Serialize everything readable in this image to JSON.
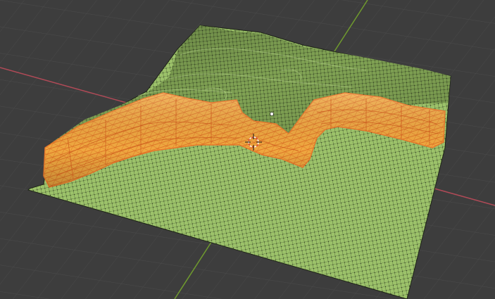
{
  "viewport": {
    "background": "#3d3d3d",
    "grid_line_color": "#4a4a4a",
    "x_axis_color": "#b04a57",
    "y_axis_color": "#6f9a2e"
  },
  "mesh": {
    "object_type": "terrain-plane",
    "vertex_grid_resolution": 92,
    "face_color": "#9cc26a",
    "face_dark_color": "#6f8f47",
    "wire_color": "#1e2417",
    "vertex_color": "#0d110a",
    "selected_face_color": "#f0a840",
    "selected_edge_color": "#e8762a",
    "features": [
      "ridge",
      "selected-wall-strip"
    ]
  },
  "cursor_3d": {
    "name": "3d-cursor"
  },
  "origin_point": {
    "name": "object-origin"
  }
}
